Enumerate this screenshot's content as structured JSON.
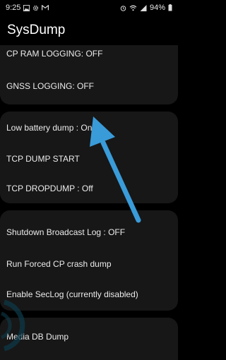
{
  "status_bar": {
    "time": "9:25",
    "battery": "94%",
    "left_icons": [
      "photo-icon",
      "settings-icon",
      "gmail-icon"
    ],
    "right_icons": [
      "alarm-icon",
      "wifi-icon",
      "signal-icon",
      "battery-icon"
    ]
  },
  "app": {
    "title": "SysDump"
  },
  "groups": [
    {
      "items": [
        "CP RAM LOGGING: OFF",
        "GNSS LOGGING: OFF"
      ]
    },
    {
      "items": [
        "Low battery dump : On",
        "TCP DUMP START",
        "TCP DROPDUMP : Off"
      ]
    },
    {
      "items": [
        "Shutdown Broadcast Log : OFF",
        "Run Forced CP crash dump",
        "Enable SecLog (currently disabled)"
      ]
    },
    {
      "items": [
        "Media DB Dump"
      ]
    }
  ],
  "colors": {
    "background": "#000000",
    "card": "#171717",
    "text": "#ececec",
    "annotation_arrow": "#3a9bd9"
  }
}
